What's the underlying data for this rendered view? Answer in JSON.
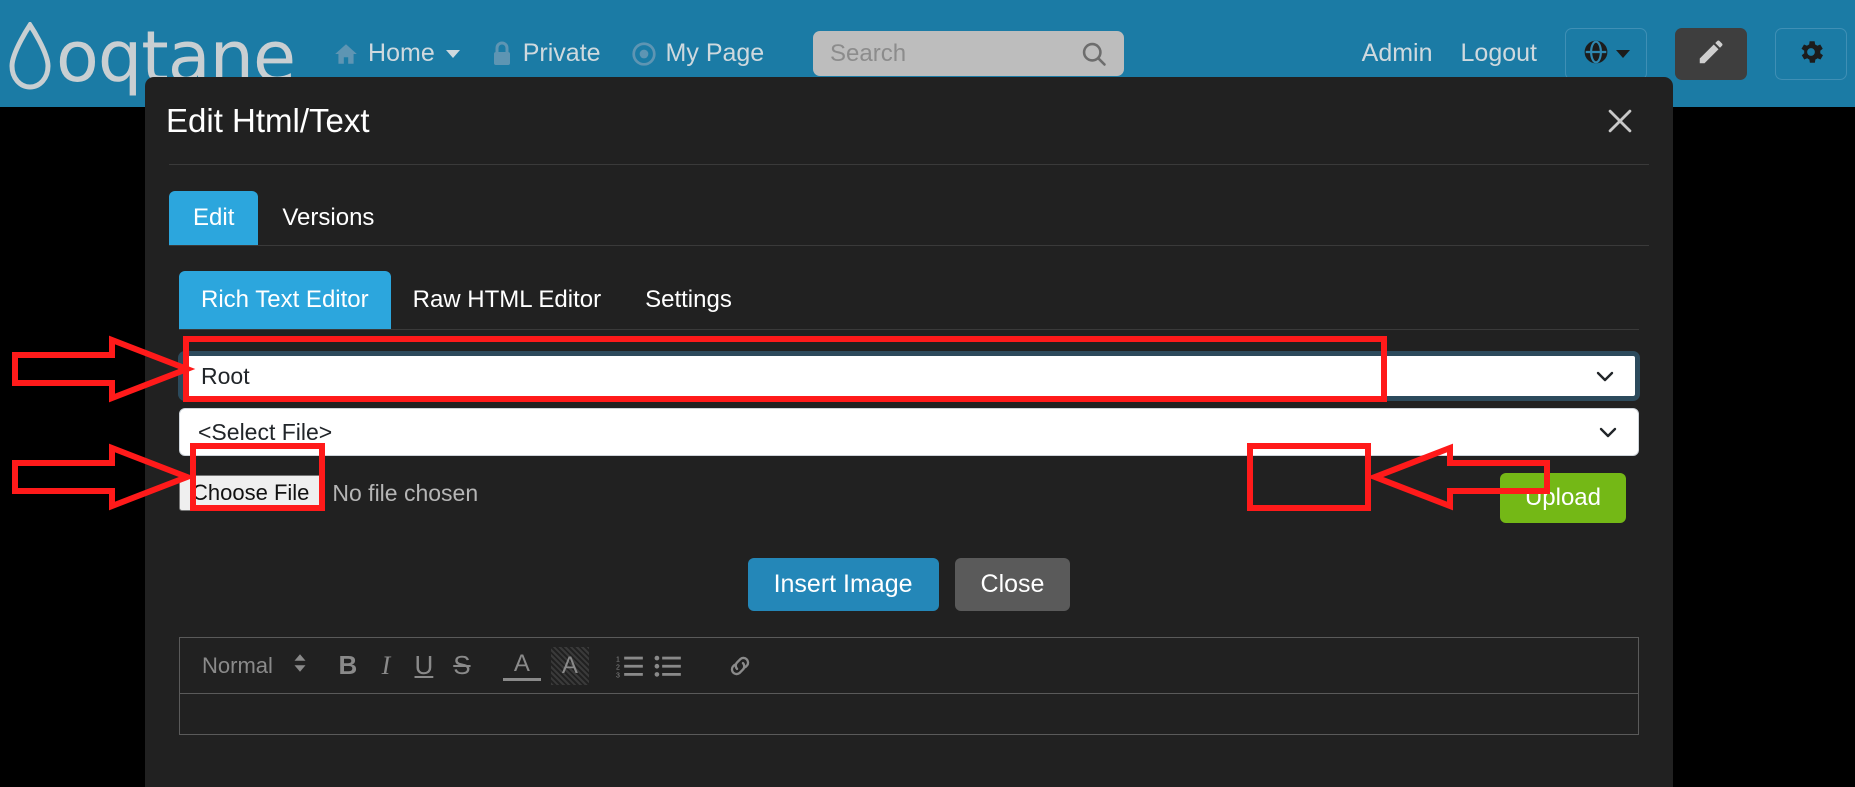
{
  "header": {
    "brand": "oqtane",
    "nav": [
      {
        "label": "Home",
        "icon": "home-icon",
        "has_caret": true
      },
      {
        "label": "Private",
        "icon": "lock-icon",
        "has_caret": false
      },
      {
        "label": "My Page",
        "icon": "target-icon",
        "has_caret": false
      }
    ],
    "search": {
      "value": "",
      "placeholder": "Search",
      "icon": "search-icon"
    },
    "links": [
      {
        "label": "Admin"
      },
      {
        "label": "Logout"
      }
    ],
    "buttons": [
      {
        "name": "language-selector",
        "icon": "globe-icon"
      },
      {
        "name": "edit-mode-button",
        "icon": "pencil-icon"
      },
      {
        "name": "settings-button",
        "icon": "gear-icon"
      }
    ]
  },
  "modal": {
    "title": "Edit Html/Text",
    "close_label": "✕",
    "tabs_primary": [
      {
        "label": "Edit",
        "active": true
      },
      {
        "label": "Versions",
        "active": false
      }
    ],
    "tabs_secondary": [
      {
        "label": "Rich Text Editor",
        "active": true
      },
      {
        "label": "Raw HTML Editor",
        "active": false
      },
      {
        "label": "Settings",
        "active": false
      }
    ],
    "folder_select": {
      "value": "Root",
      "options": [
        "Root"
      ],
      "focused": true
    },
    "file_select": {
      "value": "<Select File>",
      "options": [
        "<Select File>"
      ],
      "focused": false
    },
    "file_input": {
      "button_label": "Choose File",
      "status_text": "No file chosen"
    },
    "upload_label": "Upload",
    "insert_image_label": "Insert Image",
    "close_button_label": "Close"
  },
  "editor": {
    "format_value": "Normal",
    "tools": [
      {
        "name": "bold-icon",
        "glyph": "B"
      },
      {
        "name": "italic-icon",
        "glyph": "I"
      },
      {
        "name": "underline-icon",
        "glyph": "U"
      },
      {
        "name": "strikethrough-icon",
        "glyph": "S"
      },
      {
        "name": "text-color-icon",
        "glyph": "A"
      },
      {
        "name": "background-color-icon",
        "glyph": "A"
      },
      {
        "name": "ordered-list-icon",
        "glyph": ""
      },
      {
        "name": "bullet-list-icon",
        "glyph": ""
      },
      {
        "name": "link-icon",
        "glyph": ""
      }
    ]
  },
  "annotations": {
    "color": "#ff1a1a",
    "items": [
      {
        "name": "arrow-to-folder-select",
        "target": "folder_select"
      },
      {
        "name": "arrow-to-choose-file",
        "target": "file_input"
      },
      {
        "name": "arrow-to-upload",
        "target": "upload_button"
      }
    ]
  },
  "colors": {
    "header_bg": "#1b7ba5",
    "modal_bg": "#212121",
    "accent_blue": "#2ca6dd",
    "upload_green": "#74b816",
    "annotation_red": "#ff1a1a"
  }
}
